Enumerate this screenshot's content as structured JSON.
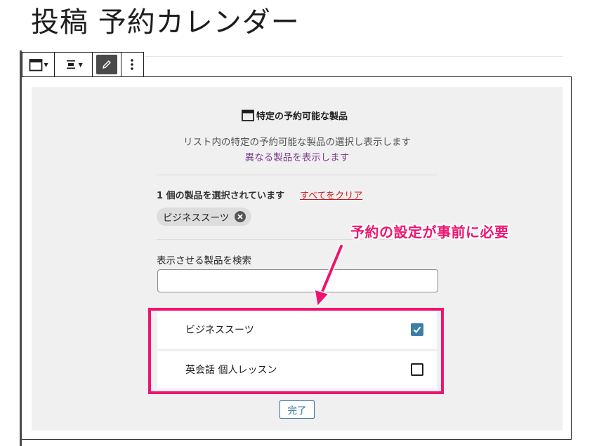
{
  "page": {
    "title": "投稿 予約カレンダー"
  },
  "toolbar": {
    "icons": [
      "calendar-icon",
      "align-icon",
      "pencil-icon",
      "more-vertical-icon"
    ]
  },
  "block": {
    "title": "特定の予約可能な製品",
    "description": "リスト内の特定の予約可能な製品の選択し表示します",
    "alt_link": "異なる製品を表示します",
    "selected_count_text": "1 個の製品を選択されています",
    "clear_all_label": "すべてをクリア",
    "selected_chip": "ビジネススーツ",
    "search_label": "表示させる製品を検索",
    "search_value": "",
    "products": [
      {
        "label": "ビジネススーツ",
        "checked": true
      },
      {
        "label": "英会話 個人レッスン",
        "checked": false
      }
    ],
    "done_label": "完了"
  },
  "annotation": {
    "callout_text": "予約の設定が事前に必要",
    "accent_color": "#f0146e"
  },
  "colors": {
    "placeholder_bg": "#f0f0f0",
    "link_purple": "#7d3d8c",
    "clear_red": "#cc1818",
    "checkbox_blue": "#3b7ea6"
  }
}
